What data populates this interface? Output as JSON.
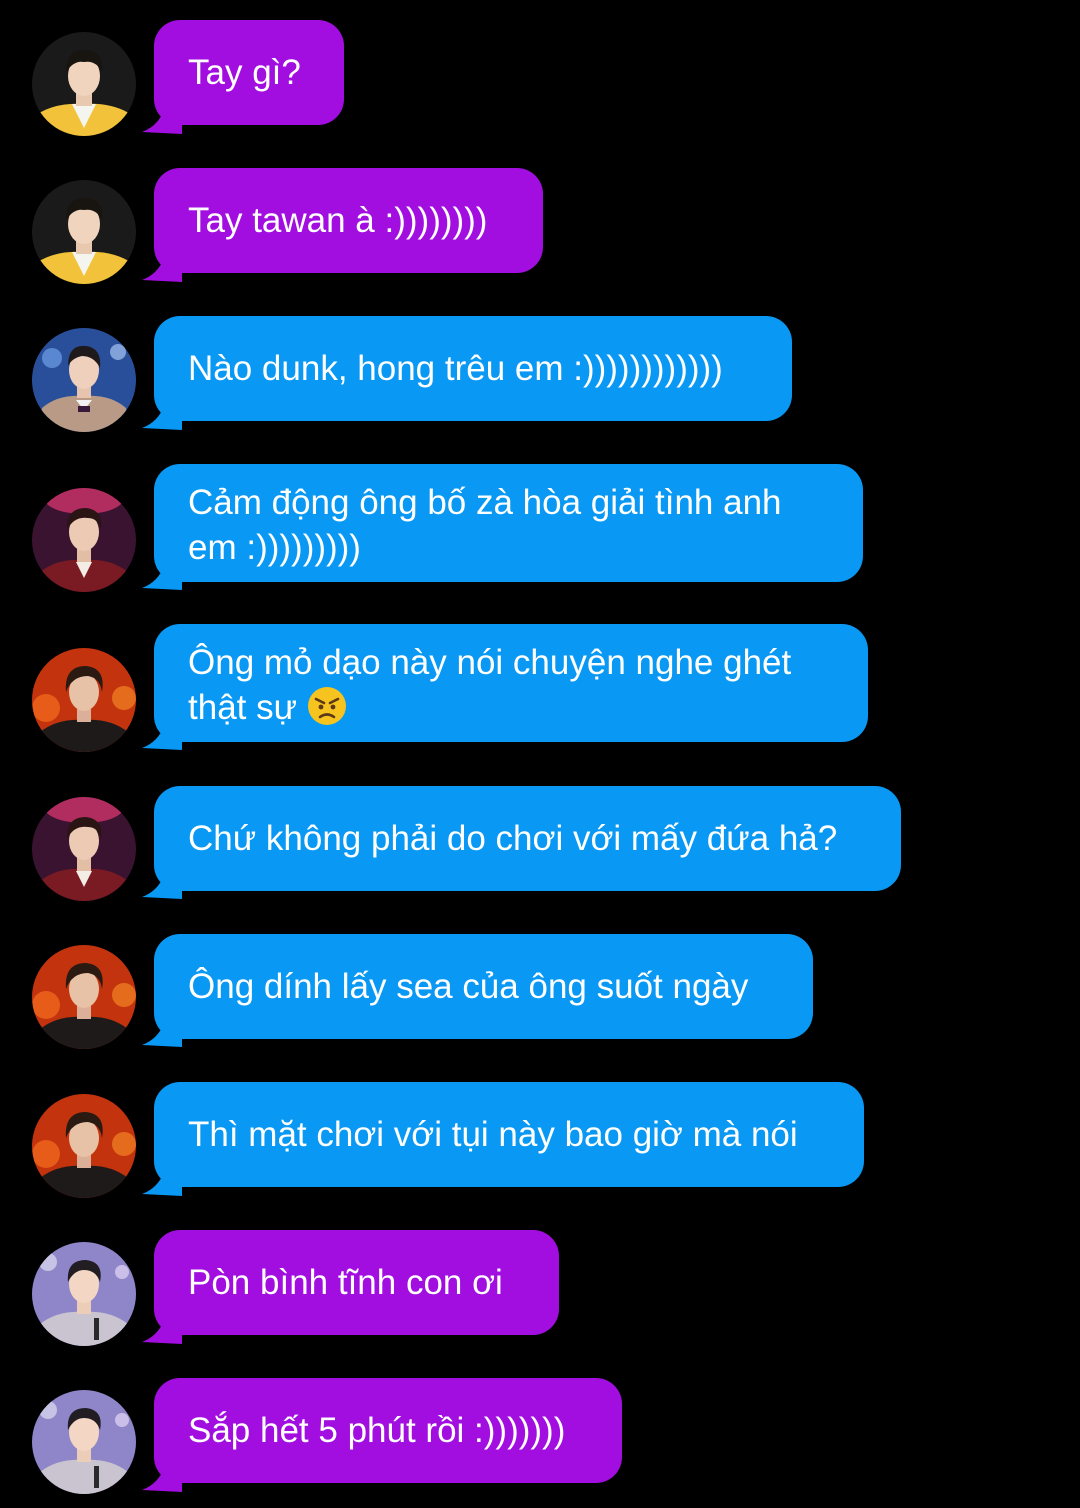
{
  "colors": {
    "background": "#000000",
    "bubble_purple": "#a20ee0",
    "bubble_blue": "#0998f4",
    "text": "#ffffff"
  },
  "messages": [
    {
      "avatar": "avatar-yellow-jacket",
      "bubble_color": "purple",
      "text": "Tay gì?"
    },
    {
      "avatar": "avatar-yellow-jacket",
      "bubble_color": "purple",
      "text": "Tay tawan à :))))))))"
    },
    {
      "avatar": "avatar-blue-stage",
      "bubble_color": "blue",
      "text": "Nào dunk, hong trêu em :))))))))))))"
    },
    {
      "avatar": "avatar-pink-stage",
      "bubble_color": "blue",
      "text": "Cảm động ông bố zà hòa giải tình anh\nem :)))))))))"
    },
    {
      "avatar": "avatar-orange-stage",
      "bubble_color": "blue",
      "text": "Ông mỏ dạo này nói chuyện nghe ghét\nthật sự",
      "emoji": "angry-face-emoji"
    },
    {
      "avatar": "avatar-pink-stage",
      "bubble_color": "blue",
      "text": "Chứ không phải do chơi với mấy đứa hả?"
    },
    {
      "avatar": "avatar-orange-stage",
      "bubble_color": "blue",
      "text": "Ông dính lấy sea của ông suốt ngày"
    },
    {
      "avatar": "avatar-orange-stage",
      "bubble_color": "blue",
      "text": "Thì mặt chơi với tụi này bao giờ mà nói"
    },
    {
      "avatar": "avatar-lilac-stage",
      "bubble_color": "purple",
      "text": "Pòn bình tĩnh con ơi"
    },
    {
      "avatar": "avatar-lilac-stage",
      "bubble_color": "purple",
      "text": "Sắp hết 5 phút rồi :)))))))"
    }
  ]
}
